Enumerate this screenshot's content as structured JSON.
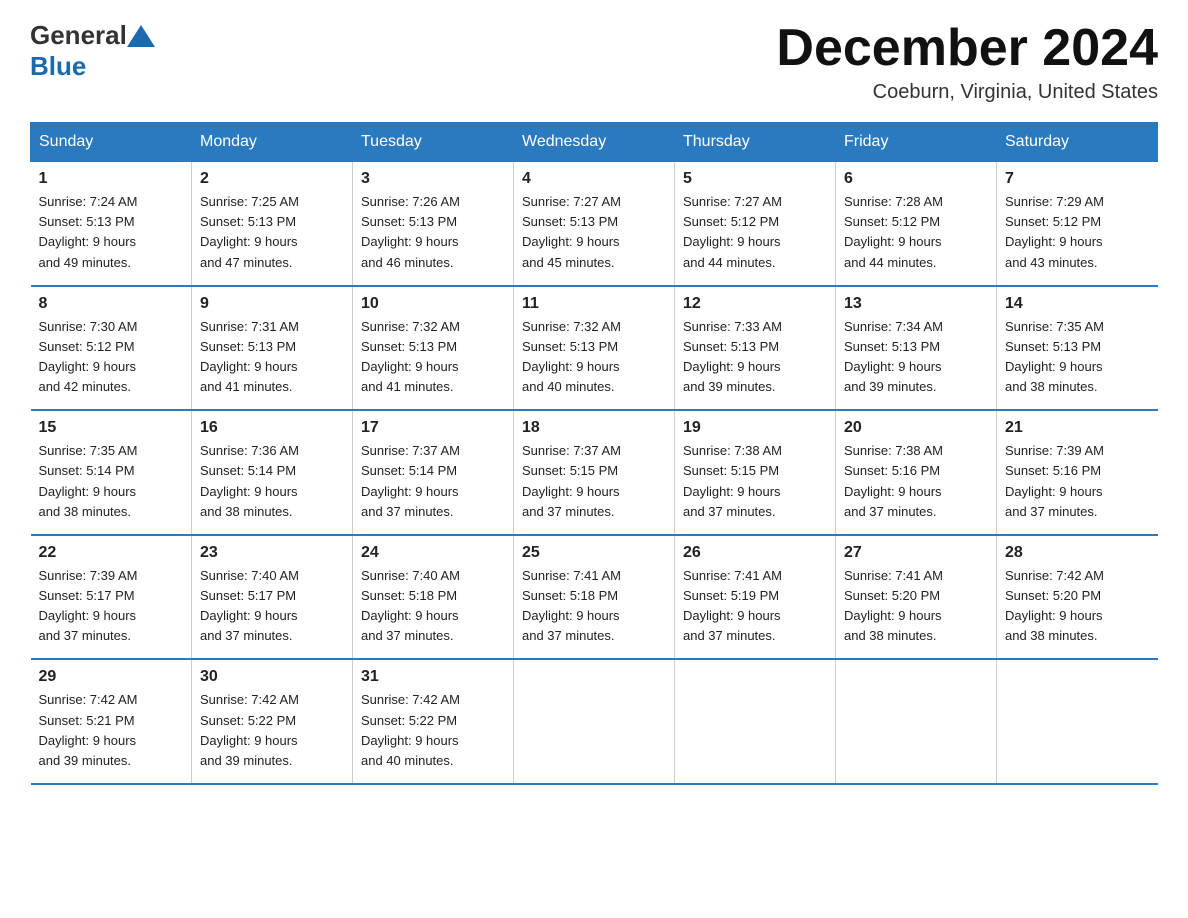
{
  "header": {
    "logo_general": "General",
    "logo_blue": "Blue",
    "month_title": "December 2024",
    "location": "Coeburn, Virginia, United States"
  },
  "days_of_week": [
    "Sunday",
    "Monday",
    "Tuesday",
    "Wednesday",
    "Thursday",
    "Friday",
    "Saturday"
  ],
  "weeks": [
    [
      {
        "num": "1",
        "sunrise": "7:24 AM",
        "sunset": "5:13 PM",
        "daylight": "9 hours and 49 minutes."
      },
      {
        "num": "2",
        "sunrise": "7:25 AM",
        "sunset": "5:13 PM",
        "daylight": "9 hours and 47 minutes."
      },
      {
        "num": "3",
        "sunrise": "7:26 AM",
        "sunset": "5:13 PM",
        "daylight": "9 hours and 46 minutes."
      },
      {
        "num": "4",
        "sunrise": "7:27 AM",
        "sunset": "5:13 PM",
        "daylight": "9 hours and 45 minutes."
      },
      {
        "num": "5",
        "sunrise": "7:27 AM",
        "sunset": "5:12 PM",
        "daylight": "9 hours and 44 minutes."
      },
      {
        "num": "6",
        "sunrise": "7:28 AM",
        "sunset": "5:12 PM",
        "daylight": "9 hours and 44 minutes."
      },
      {
        "num": "7",
        "sunrise": "7:29 AM",
        "sunset": "5:12 PM",
        "daylight": "9 hours and 43 minutes."
      }
    ],
    [
      {
        "num": "8",
        "sunrise": "7:30 AM",
        "sunset": "5:12 PM",
        "daylight": "9 hours and 42 minutes."
      },
      {
        "num": "9",
        "sunrise": "7:31 AM",
        "sunset": "5:13 PM",
        "daylight": "9 hours and 41 minutes."
      },
      {
        "num": "10",
        "sunrise": "7:32 AM",
        "sunset": "5:13 PM",
        "daylight": "9 hours and 41 minutes."
      },
      {
        "num": "11",
        "sunrise": "7:32 AM",
        "sunset": "5:13 PM",
        "daylight": "9 hours and 40 minutes."
      },
      {
        "num": "12",
        "sunrise": "7:33 AM",
        "sunset": "5:13 PM",
        "daylight": "9 hours and 39 minutes."
      },
      {
        "num": "13",
        "sunrise": "7:34 AM",
        "sunset": "5:13 PM",
        "daylight": "9 hours and 39 minutes."
      },
      {
        "num": "14",
        "sunrise": "7:35 AM",
        "sunset": "5:13 PM",
        "daylight": "9 hours and 38 minutes."
      }
    ],
    [
      {
        "num": "15",
        "sunrise": "7:35 AM",
        "sunset": "5:14 PM",
        "daylight": "9 hours and 38 minutes."
      },
      {
        "num": "16",
        "sunrise": "7:36 AM",
        "sunset": "5:14 PM",
        "daylight": "9 hours and 38 minutes."
      },
      {
        "num": "17",
        "sunrise": "7:37 AM",
        "sunset": "5:14 PM",
        "daylight": "9 hours and 37 minutes."
      },
      {
        "num": "18",
        "sunrise": "7:37 AM",
        "sunset": "5:15 PM",
        "daylight": "9 hours and 37 minutes."
      },
      {
        "num": "19",
        "sunrise": "7:38 AM",
        "sunset": "5:15 PM",
        "daylight": "9 hours and 37 minutes."
      },
      {
        "num": "20",
        "sunrise": "7:38 AM",
        "sunset": "5:16 PM",
        "daylight": "9 hours and 37 minutes."
      },
      {
        "num": "21",
        "sunrise": "7:39 AM",
        "sunset": "5:16 PM",
        "daylight": "9 hours and 37 minutes."
      }
    ],
    [
      {
        "num": "22",
        "sunrise": "7:39 AM",
        "sunset": "5:17 PM",
        "daylight": "9 hours and 37 minutes."
      },
      {
        "num": "23",
        "sunrise": "7:40 AM",
        "sunset": "5:17 PM",
        "daylight": "9 hours and 37 minutes."
      },
      {
        "num": "24",
        "sunrise": "7:40 AM",
        "sunset": "5:18 PM",
        "daylight": "9 hours and 37 minutes."
      },
      {
        "num": "25",
        "sunrise": "7:41 AM",
        "sunset": "5:18 PM",
        "daylight": "9 hours and 37 minutes."
      },
      {
        "num": "26",
        "sunrise": "7:41 AM",
        "sunset": "5:19 PM",
        "daylight": "9 hours and 37 minutes."
      },
      {
        "num": "27",
        "sunrise": "7:41 AM",
        "sunset": "5:20 PM",
        "daylight": "9 hours and 38 minutes."
      },
      {
        "num": "28",
        "sunrise": "7:42 AM",
        "sunset": "5:20 PM",
        "daylight": "9 hours and 38 minutes."
      }
    ],
    [
      {
        "num": "29",
        "sunrise": "7:42 AM",
        "sunset": "5:21 PM",
        "daylight": "9 hours and 39 minutes."
      },
      {
        "num": "30",
        "sunrise": "7:42 AM",
        "sunset": "5:22 PM",
        "daylight": "9 hours and 39 minutes."
      },
      {
        "num": "31",
        "sunrise": "7:42 AM",
        "sunset": "5:22 PM",
        "daylight": "9 hours and 40 minutes."
      },
      null,
      null,
      null,
      null
    ]
  ],
  "labels": {
    "sunrise_prefix": "Sunrise: ",
    "sunset_prefix": "Sunset: ",
    "daylight_prefix": "Daylight: 9 hours"
  }
}
